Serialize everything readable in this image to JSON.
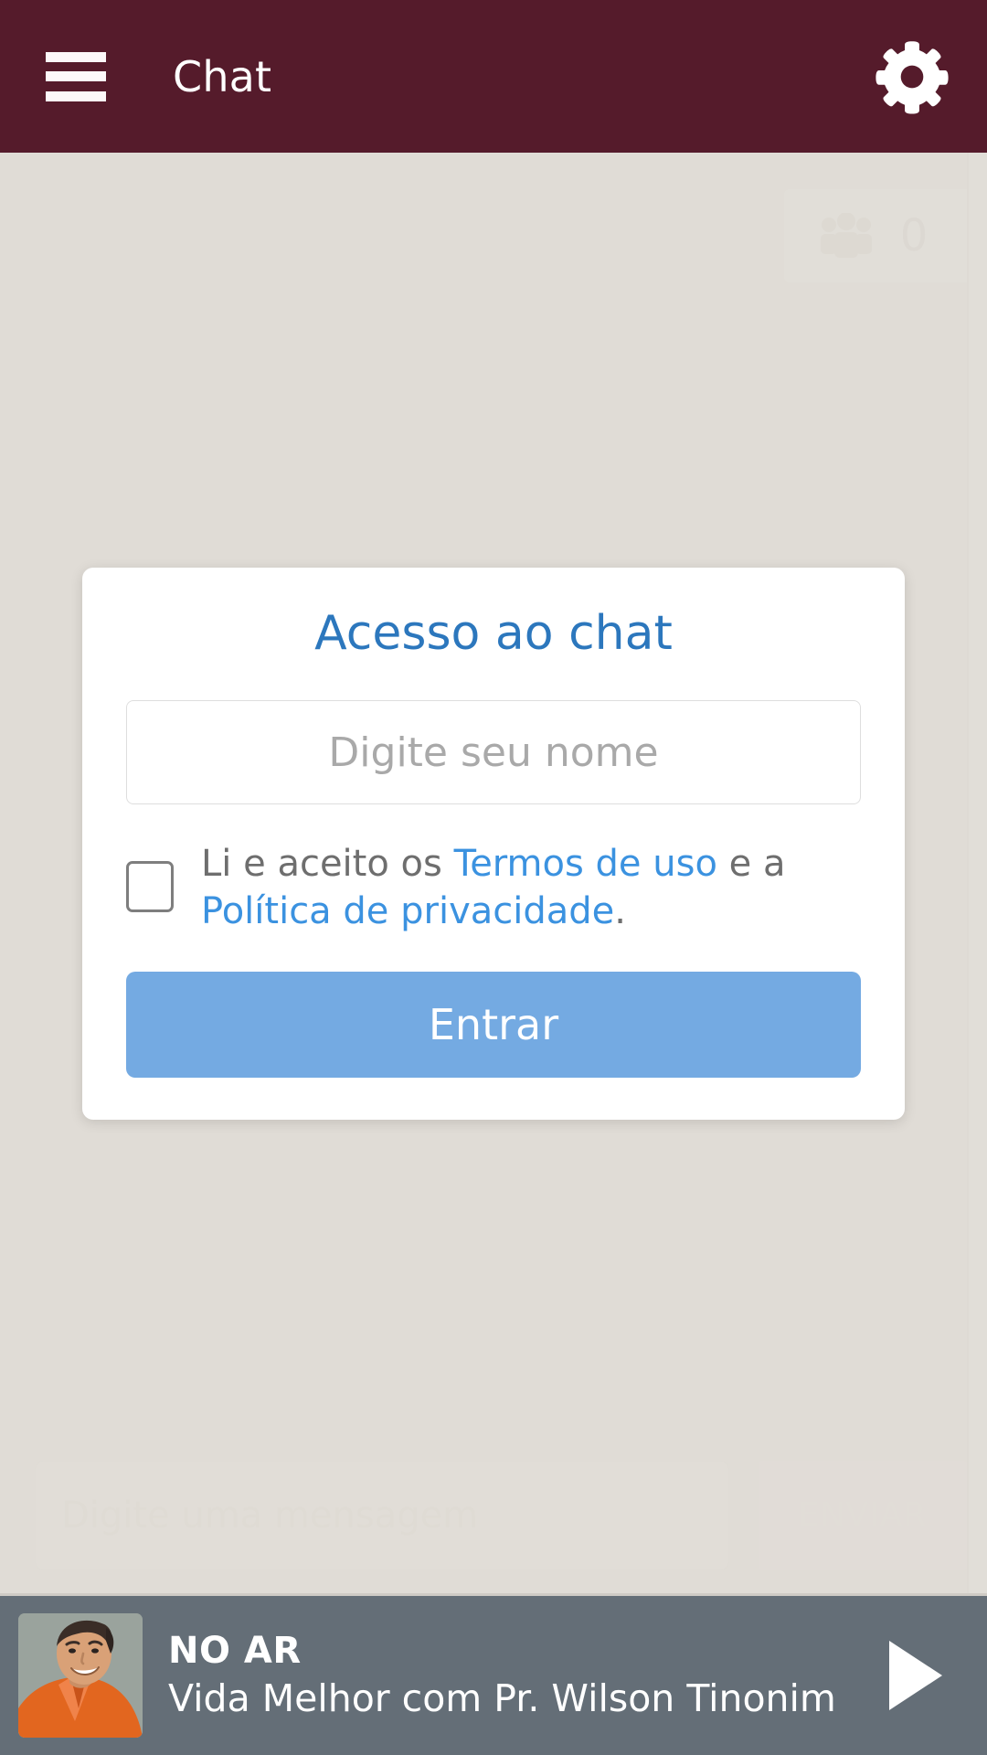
{
  "header": {
    "title": "Chat",
    "menu_icon": "hamburger-menu-icon",
    "settings_icon": "gear-icon"
  },
  "chat": {
    "users_icon": "users-group-icon",
    "users_count": "0",
    "composer_placeholder": "Digite uma mensagem",
    "send_label": "ENVIAR"
  },
  "login_modal": {
    "title": "Acesso ao chat",
    "name_placeholder": "Digite seu nome",
    "name_value": "",
    "terms": {
      "prefix": "Li e aceito os ",
      "terms_link": "Termos de uso",
      "middle": " e a ",
      "privacy_link": "Política de privacidade",
      "suffix": "."
    },
    "submit_label": "Entrar",
    "checkbox_checked": false
  },
  "player": {
    "kicker": "NO AR",
    "title": "Vida Melhor com Pr. Wilson Tinonim",
    "play_icon": "play-triangle-icon",
    "thumbnail_alt": "smiling-man-orange-shirt-photo"
  },
  "colors": {
    "header_bg": "#551b2b",
    "page_bg": "#e0dcd6",
    "card_bg": "#ffffff",
    "title_blue": "#2c77bd",
    "link_blue": "#3b92e0",
    "button_blue": "#74aae2",
    "player_bg": "#646e77"
  }
}
